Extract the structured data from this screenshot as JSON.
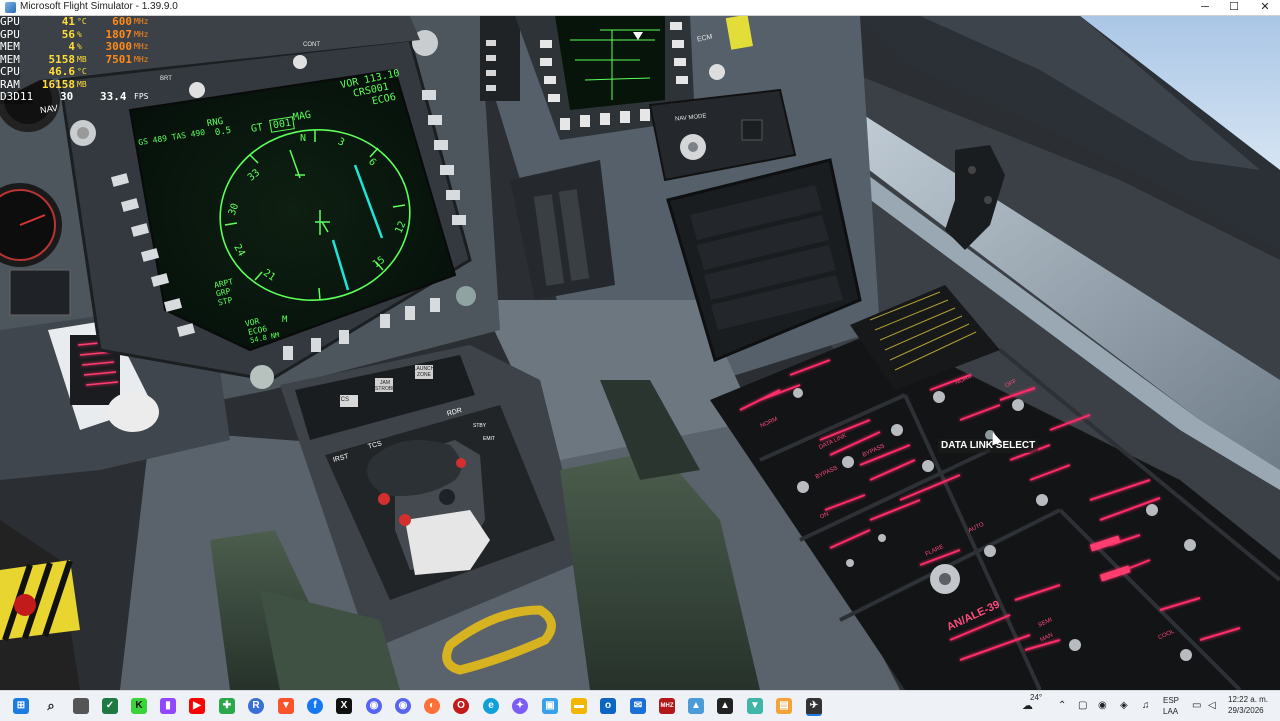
{
  "window": {
    "title": "Microsoft Flight Simulator - 1.39.9.0",
    "minimize": "─",
    "maximize": "☐",
    "close": "✕"
  },
  "overlay": {
    "rows": [
      {
        "label": "GPU",
        "value": "41",
        "unit": "°C",
        "value2": "600",
        "unit2": "MHz"
      },
      {
        "label": "GPU",
        "value": "56",
        "unit": "%",
        "value2": "1807",
        "unit2": "MHz"
      },
      {
        "label": "MEM",
        "value": "4",
        "unit": "%",
        "value2": "3000",
        "unit2": "MHz"
      },
      {
        "label": "MEM",
        "value": "5158",
        "unit": "MB",
        "value2": "7501",
        "unit2": "MHz"
      },
      {
        "label": "CPU",
        "value": "46.6",
        "unit": "°C",
        "value2": "",
        "unit2": ""
      },
      {
        "label": "RAM",
        "value": "16158",
        "unit": "MB",
        "value2": "",
        "unit2": ""
      }
    ],
    "d3d": {
      "label": "D3D11",
      "fps": "30",
      "frametime": "33.4",
      "unit": "FPS"
    }
  },
  "mfd": {
    "top_left": "GS 489 TAS 490",
    "rng_label": "RNG",
    "rng_value": "0.5",
    "gt": "GT",
    "heading": "001",
    "mag": "MAG",
    "vor": "VOR 113.10",
    "crs": "CRS001",
    "id": "ECO6",
    "bottom_left_1": "VOR",
    "bottom_left_2": "ECO6",
    "bottom_left_3": "54.8 NM",
    "m_label": "M",
    "arpt": "ARPT",
    "grp": "GRP",
    "stp": "STP",
    "nav_label": "NAV",
    "compass": [
      "33",
      "30",
      "24",
      "21",
      "15",
      "12",
      "6",
      "3",
      "N"
    ]
  },
  "panels": {
    "brt": "BRT",
    "cont": "CONT",
    "ecm": "ECM",
    "nav_mode": "NAV MODE",
    "tcs": "TCS",
    "jam_strobe": "JAM STROBE",
    "launch_zone": "LAUNCH ZONE",
    "irst": "IRST",
    "rdr": "RDR",
    "stby": "STBY",
    "emit": "EMIT",
    "anale": "AN/ALE-39",
    "flare": "FLARE",
    "auto": "AUTO",
    "semi": "SEMI",
    "man": "MAN",
    "data_link": "DATA LINK",
    "bypass": "BYPASS",
    "norm": "NORM",
    "off": "OFF",
    "on": "ON",
    "cool": "COOL"
  },
  "tooltip": "DATA LINK SELECT",
  "taskbar": {
    "weather": "24°",
    "lang1": "ESP",
    "lang2": "LAA",
    "time": "12:22 a. m.",
    "date": "29/3/2026",
    "apps": [
      "start-icon",
      "search-icon",
      "task-view-icon",
      "excel-icon",
      "kick-icon",
      "twitch-icon",
      "youtube-icon",
      "xbox-icon",
      "r-icon",
      "brave-icon",
      "facebook-icon",
      "x-icon",
      "discord-icon",
      "discord-icon",
      "firefox-icon",
      "opera-icon",
      "edge-icon",
      "copilot-icon",
      "photos-icon",
      "explorer-icon",
      "outlook-icon",
      "mhz-icon",
      "photos2-icon",
      "adobe-icon",
      "vpn-icon",
      "store-icon",
      "flightsim-icon"
    ]
  },
  "colors": {
    "mfd_green": "#5dff5a",
    "backlight_red": "#ff2c6a",
    "hud_yellow": "#ffdc3a",
    "hud_orange": "#ff8a1a",
    "cyan_needle": "#1de6d8",
    "cockpit_gray": "#5a6066",
    "seat_green": "#3c4c3e"
  }
}
